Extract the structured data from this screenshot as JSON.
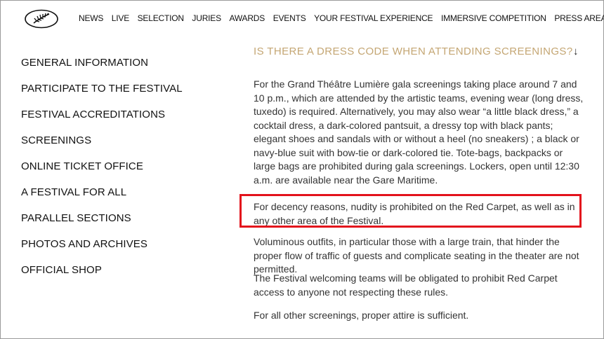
{
  "nav": {
    "logo": "palm-logo-icon",
    "items": [
      "NEWS",
      "LIVE",
      "SELECTION",
      "JURIES",
      "AWARDS",
      "EVENTS",
      "YOUR FESTIVAL EXPERIENCE",
      "IMMERSIVE COMPETITION",
      "PRESS AREA"
    ]
  },
  "sidebar": {
    "items": [
      "GENERAL INFORMATION",
      "PARTICIPATE TO THE FESTIVAL",
      "FESTIVAL ACCREDITATIONS",
      "SCREENINGS",
      "ONLINE TICKET OFFICE",
      "A FESTIVAL FOR ALL",
      "PARALLEL SECTIONS",
      "PHOTOS AND ARCHIVES",
      "OFFICIAL SHOP"
    ]
  },
  "faq": {
    "question": "IS THERE A DRESS CODE WHEN ATTENDING SCREENINGS?",
    "toggle_icon": "arrow-down-icon",
    "toggle_glyph": "↓",
    "paragraphs": [
      "For the Grand Théâtre Lumière gala screenings taking place around 7 and 10 p.m., which are attended by the artistic teams, evening wear (long dress, tuxedo) is required. Alternatively, you may also wear “a little black dress,” a cocktail dress, a dark-colored pantsuit, a dressy top with black pants; elegant shoes and sandals with or without a heel (no sneakers) ; a black or navy-blue suit with bow-tie or dark-colored tie. Tote-bags, backpacks or large bags are prohibited during gala screenings. Lockers, open until 12:30 a.m. are available near the Gare Maritime.",
      "For decency reasons, nudity is prohibited on the Red Carpet, as well as in any other area of the Festival.",
      "Voluminous outfits, in particular those with a large train, that hinder the proper flow of traffic of guests and complicate seating in the theater are not permitted.",
      "The Festival welcoming teams will be obligated to prohibit Red Carpet access to anyone not respecting these rules.",
      "For all other screenings, proper attire is sufficient."
    ]
  },
  "colors": {
    "question": "#c4a673",
    "highlight_border": "#e3121c"
  }
}
